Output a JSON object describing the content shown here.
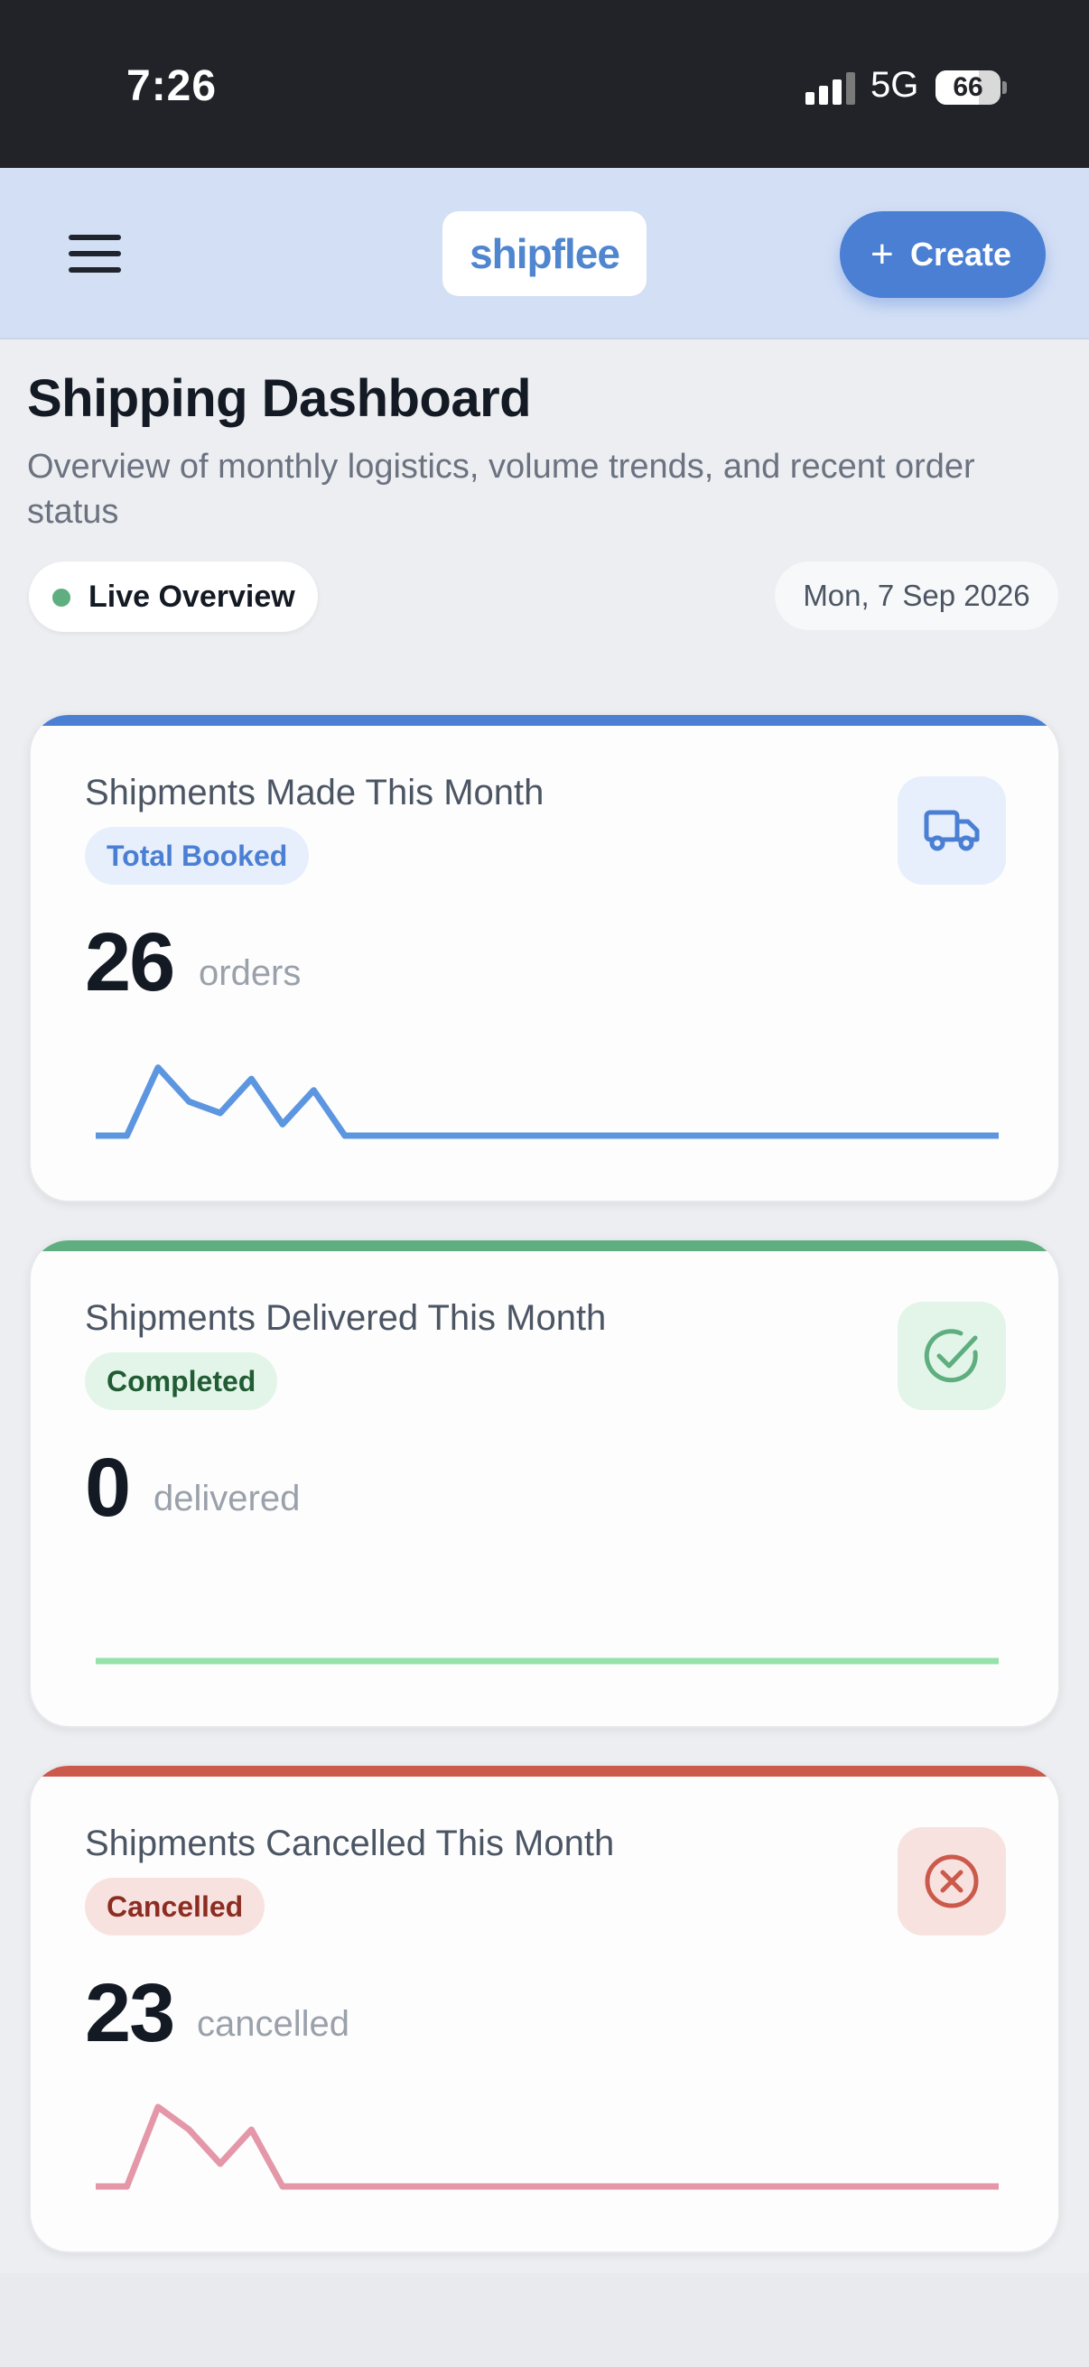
{
  "status_bar": {
    "time": "7:26",
    "network": "5G",
    "battery_percent": "66"
  },
  "header": {
    "logo_text": "shipflee",
    "create_label": "Create",
    "create_icon": "plus-icon",
    "menu_icon": "hamburger-menu-icon"
  },
  "page": {
    "title": "Shipping Dashboard",
    "subtitle": "Overview of monthly logistics, volume trends, and recent order status",
    "live_label": "Live Overview",
    "date": "Mon, 7 Sep 2026"
  },
  "cards": [
    {
      "title": "Shipments Made This Month",
      "badge": "Total Booked",
      "value": "26",
      "unit": "orders",
      "icon": "truck-icon",
      "accent": "#4a7fd4",
      "badge_bg": "#e6effb",
      "badge_color": "#4a7fd4",
      "icon_bg": "#e6effb",
      "line_color": "#5d96e0",
      "trend": [
        0,
        0,
        6,
        3,
        2,
        5,
        1,
        4,
        0,
        0,
        0,
        0,
        0,
        0,
        0,
        0,
        0,
        0,
        0,
        0,
        0,
        0,
        0,
        0,
        0,
        0,
        0,
        0,
        0,
        0
      ]
    },
    {
      "title": "Shipments Delivered This Month",
      "badge": "Completed",
      "value": "0",
      "unit": "delivered",
      "icon": "check-circle-icon",
      "accent": "#5fae7f",
      "badge_bg": "#e2f5e8",
      "badge_color": "#215c34",
      "icon_bg": "#e2f5e8",
      "line_color": "#97e2aa",
      "trend": [
        0,
        0,
        0,
        0,
        0,
        0,
        0,
        0,
        0,
        0,
        0,
        0,
        0,
        0,
        0,
        0,
        0,
        0,
        0,
        0,
        0,
        0,
        0,
        0,
        0,
        0,
        0,
        0,
        0,
        0
      ]
    },
    {
      "title": "Shipments Cancelled This Month",
      "badge": "Cancelled",
      "value": "23",
      "unit": "cancelled",
      "icon": "x-circle-icon",
      "accent": "#cb5a4c",
      "badge_bg": "#f8e2e0",
      "badge_color": "#8c2d22",
      "icon_bg": "#f8e2e0",
      "line_color": "#e497a8",
      "trend": [
        0,
        0,
        7,
        5,
        2,
        5,
        0,
        0,
        0,
        0,
        0,
        0,
        0,
        0,
        0,
        0,
        0,
        0,
        0,
        0,
        0,
        0,
        0,
        0,
        0,
        0,
        0,
        0,
        0,
        0
      ]
    }
  ]
}
